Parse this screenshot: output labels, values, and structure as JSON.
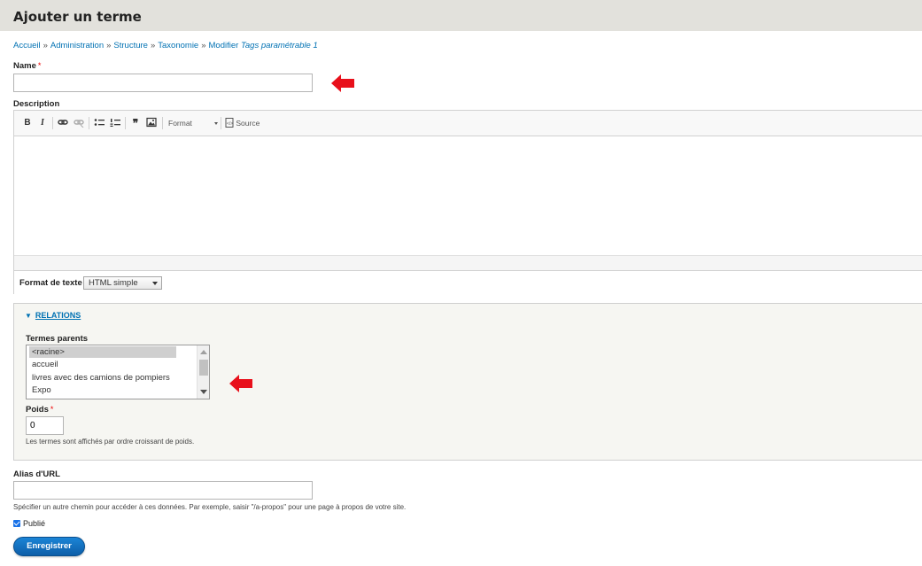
{
  "page": {
    "title": "Ajouter un terme"
  },
  "breadcrumb": {
    "items": [
      "Accueil",
      "Administration",
      "Structure",
      "Taxonomie",
      "Modifier"
    ],
    "current": "Tags paramétrable 1",
    "separator": "»"
  },
  "form": {
    "name": {
      "label": "Name",
      "required_mark": "*",
      "value": ""
    },
    "description": {
      "label": "Description",
      "toolbar": {
        "bold": "B",
        "italic": "I",
        "link_icon": "link-icon",
        "unlink_icon": "unlink-icon",
        "bulleted_list_icon": "bulleted-list-icon",
        "numbered_list_icon": "numbered-list-icon",
        "blockquote": "❞",
        "image_icon": "image-icon",
        "format_label": "Format",
        "source_label": "Source"
      },
      "text_format": {
        "label": "Format de texte",
        "value": "HTML simple"
      }
    },
    "relations": {
      "legend": "RELATIONS",
      "parents": {
        "label": "Termes parents",
        "options": [
          "<racine>",
          "accueil",
          "livres avec des camions de pompiers",
          "Expo"
        ],
        "selected": "<racine>"
      },
      "weight": {
        "label": "Poids",
        "required_mark": "*",
        "value": "0",
        "help": "Les termes sont affichés par ordre croissant de poids."
      }
    },
    "url_alias": {
      "label": "Alias d'URL",
      "value": "",
      "help": "Spécifier un autre chemin pour accéder à ces données. Par exemple, saisir \"/a-propos\" pour une page à propos de votre site."
    },
    "published": {
      "label": "Publié",
      "checked": true
    },
    "save_label": "Enregistrer"
  },
  "colors": {
    "header_bg": "#e2e1dc",
    "link": "#0071b3",
    "annotation_arrow": "#e8101b",
    "button": "#0d6fc4"
  }
}
